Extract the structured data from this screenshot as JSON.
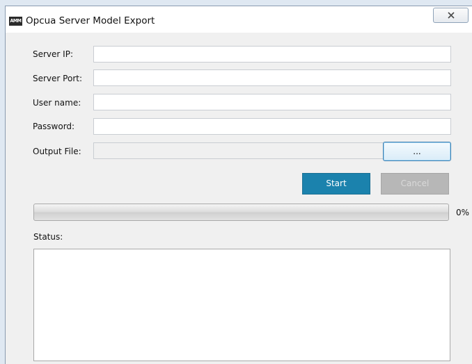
{
  "window": {
    "icon_text": "AMM",
    "title": "Opcua Server Model Export",
    "close_icon": "close-icon"
  },
  "form": {
    "server_ip": {
      "label": "Server IP:",
      "value": ""
    },
    "server_port": {
      "label": "Server Port:",
      "value": ""
    },
    "user_name": {
      "label": "User name:",
      "value": ""
    },
    "password": {
      "label": "Password:",
      "value": ""
    },
    "output_file": {
      "label": "Output File:",
      "value": "",
      "browse_label": "..."
    }
  },
  "actions": {
    "start_label": "Start",
    "cancel_label": "Cancel",
    "cancel_enabled": false
  },
  "progress": {
    "value": 0,
    "text": "0%"
  },
  "status": {
    "label": "Status:",
    "text": ""
  },
  "colors": {
    "accent": "#1b82ad",
    "disabled": "#b7b7b7"
  }
}
